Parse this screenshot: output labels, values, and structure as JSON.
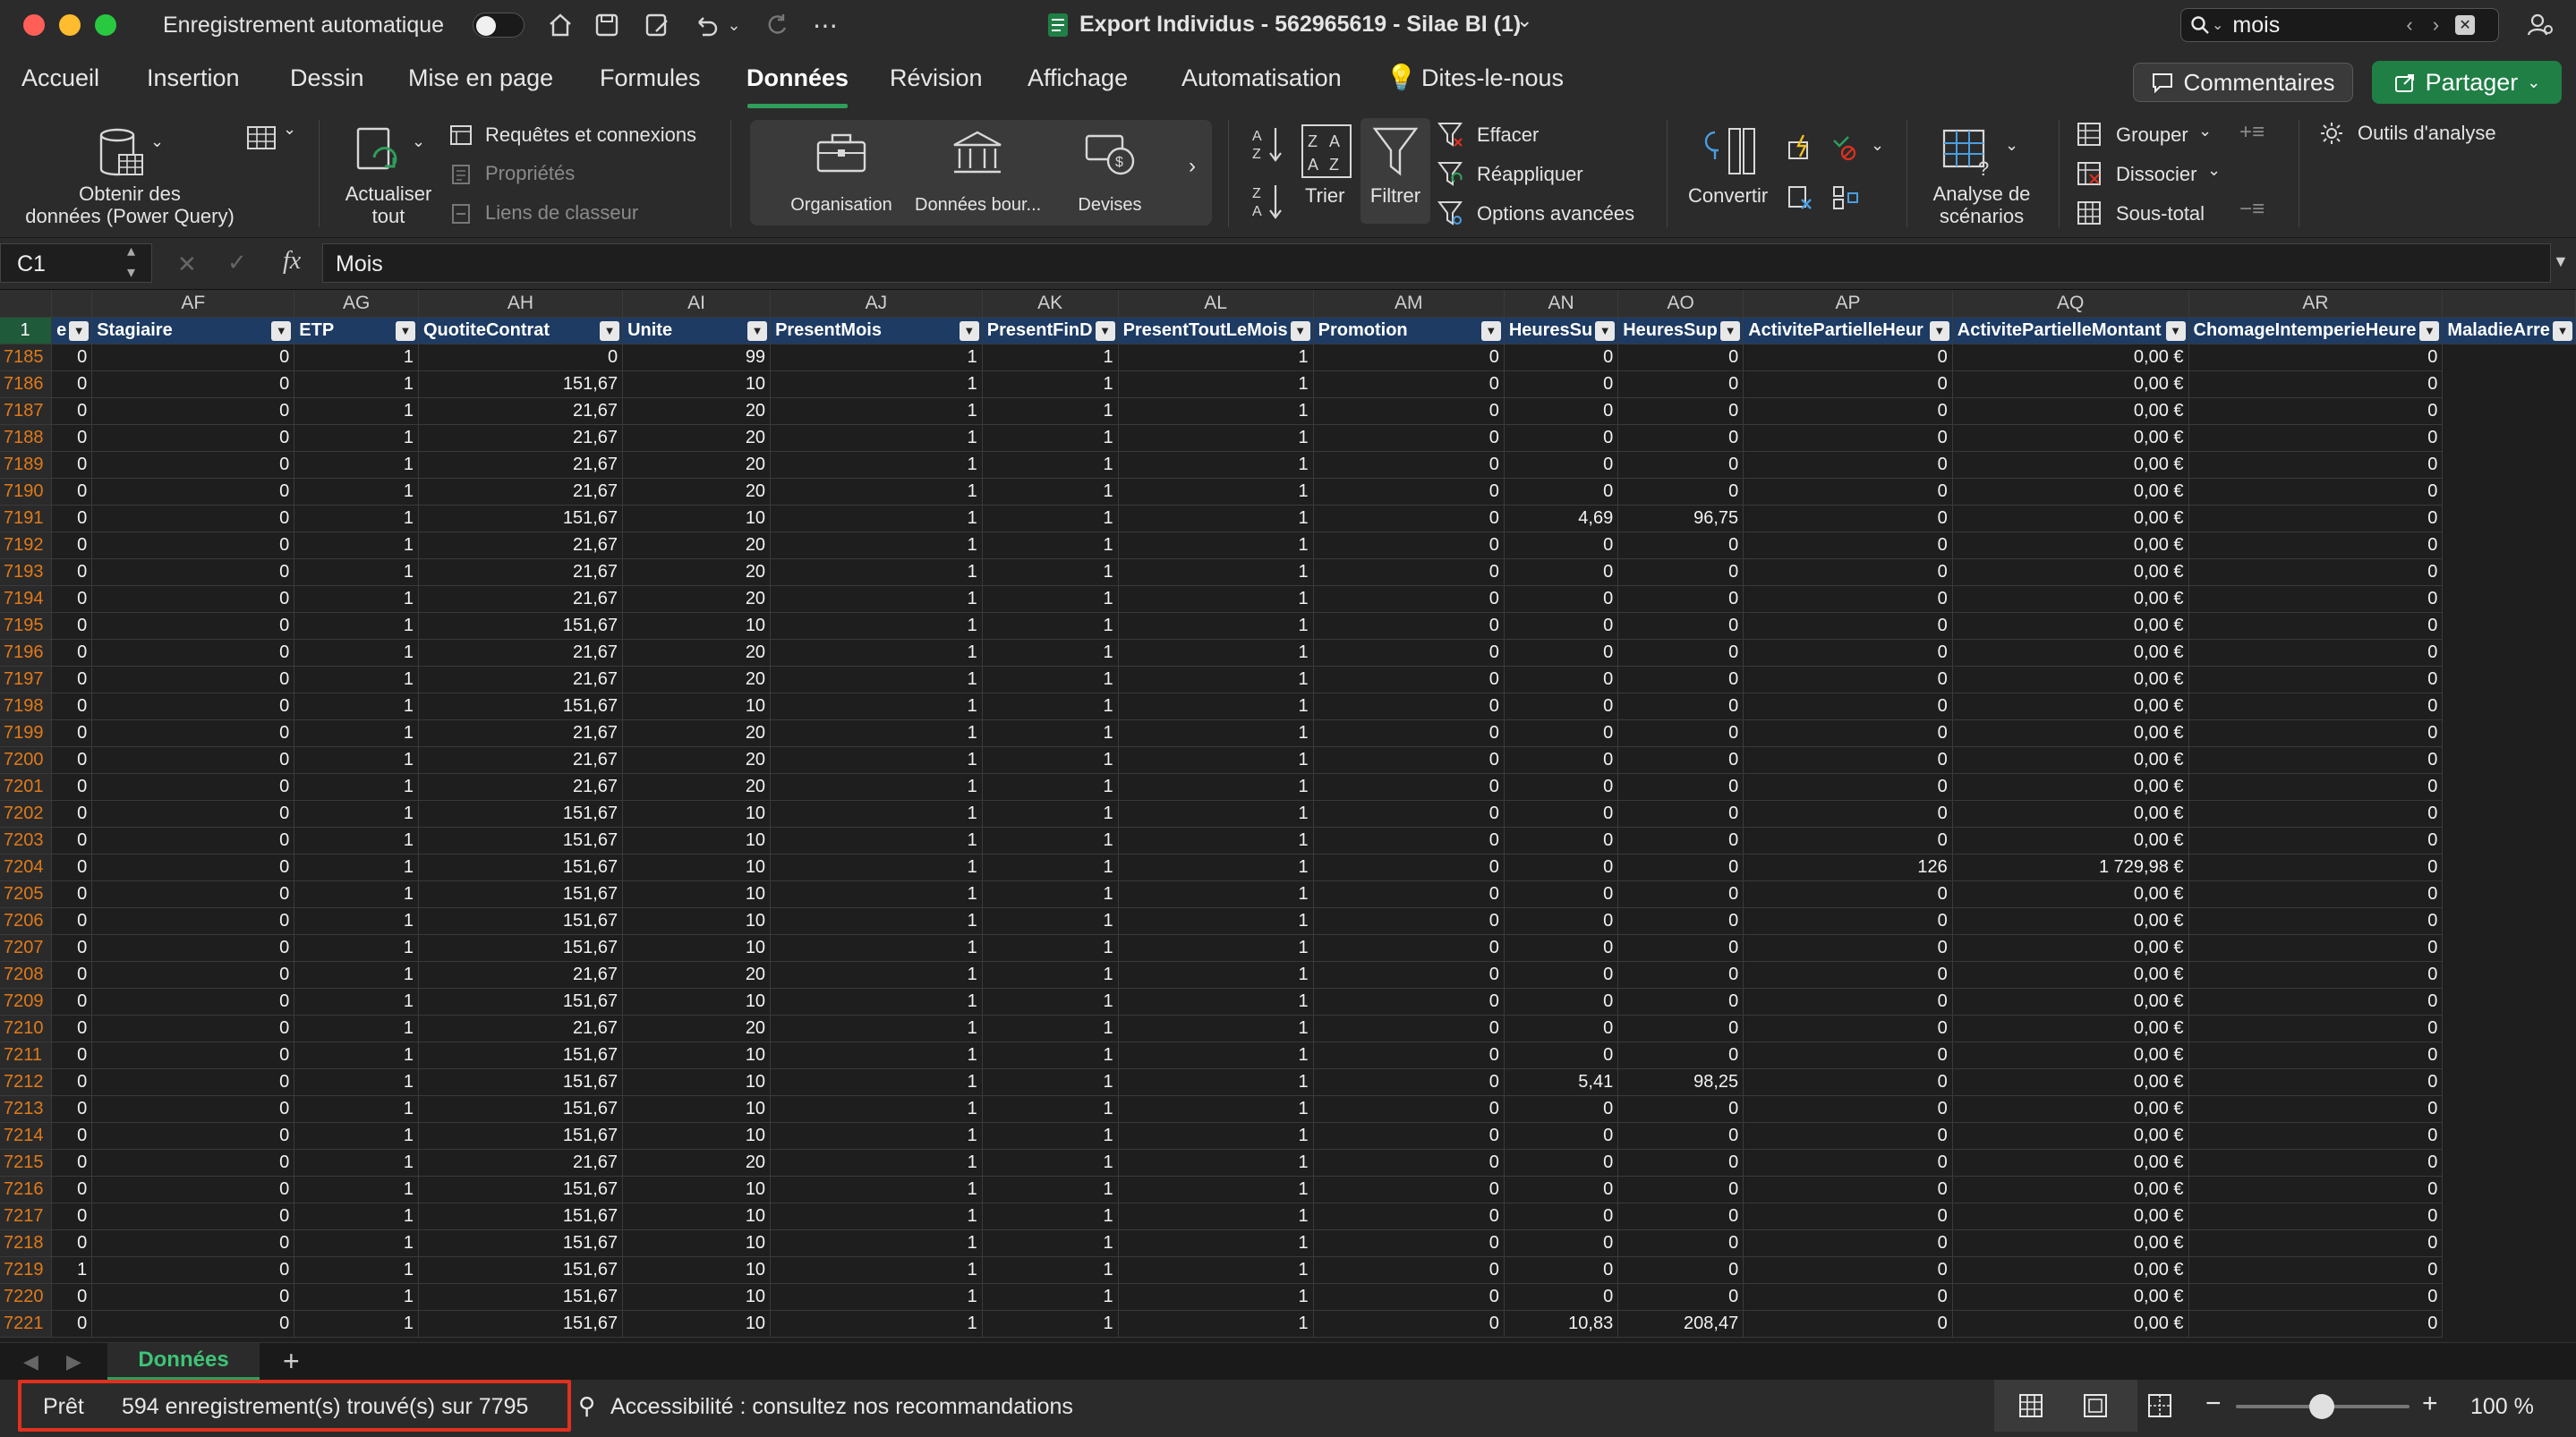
{
  "titlebar": {
    "autosave_label": "Enregistrement automatique",
    "title": "Export Individus - 562965619 - Silae BI (1)",
    "search_value": "mois"
  },
  "menu": {
    "tabs": [
      "Accueil",
      "Insertion",
      "Dessin",
      "Mise en page",
      "Formules",
      "Données",
      "Révision",
      "Affichage",
      "Automatisation",
      "Dites-le-nous"
    ],
    "active": "Données",
    "comments": "Commentaires",
    "share": "Partager"
  },
  "ribbon": {
    "get_data": [
      "Obtenir des",
      "données (Power Query)"
    ],
    "refresh": [
      "Actualiser",
      "tout"
    ],
    "queries": "Requêtes et connexions",
    "properties": "Propriétés",
    "links": "Liens de classeur",
    "dt_org": "Organisation",
    "dt_stock": "Données bour...",
    "dt_currency": "Devises",
    "sort": "Trier",
    "filter": "Filtrer",
    "clear": "Effacer",
    "reapply": "Réappliquer",
    "advanced": "Options avancées",
    "convert": "Convertir",
    "whatif": [
      "Analyse de",
      "scénarios"
    ],
    "group": "Grouper",
    "ungroup": "Dissocier",
    "subtotal": "Sous-total",
    "analysis": "Outils d'analyse"
  },
  "formulabar": {
    "cell": "C1",
    "fx": "fx",
    "value": "Mois"
  },
  "grid": {
    "columns": [
      "AF",
      "AG",
      "AH",
      "AI",
      "AJ",
      "AK",
      "AL",
      "AM",
      "AN",
      "AO",
      "AP",
      "AQ",
      "AR"
    ],
    "headers": [
      "e",
      "Stagiaire",
      "ETP",
      "QuotiteContrat",
      "Unite",
      "PresentMois",
      "PresentFinD",
      "PresentToutLeMois",
      "Promotion",
      "HeuresSu",
      "HeuresSup",
      "ActivitePartielleHeur",
      "ActivitePartielleMontant",
      "ChomageIntemperieHeure",
      "MaladieArre"
    ],
    "rows": [
      [
        "7185",
        "0",
        "0",
        "1",
        "0",
        "99",
        "1",
        "1",
        "1",
        "0",
        "0",
        "0",
        "0",
        "0,00 €",
        "0"
      ],
      [
        "7186",
        "0",
        "0",
        "1",
        "151,67",
        "10",
        "1",
        "1",
        "1",
        "0",
        "0",
        "0",
        "0",
        "0,00 €",
        "0"
      ],
      [
        "7187",
        "0",
        "0",
        "1",
        "21,67",
        "20",
        "1",
        "1",
        "1",
        "0",
        "0",
        "0",
        "0",
        "0,00 €",
        "0"
      ],
      [
        "7188",
        "0",
        "0",
        "1",
        "21,67",
        "20",
        "1",
        "1",
        "1",
        "0",
        "0",
        "0",
        "0",
        "0,00 €",
        "0"
      ],
      [
        "7189",
        "0",
        "0",
        "1",
        "21,67",
        "20",
        "1",
        "1",
        "1",
        "0",
        "0",
        "0",
        "0",
        "0,00 €",
        "0"
      ],
      [
        "7190",
        "0",
        "0",
        "1",
        "21,67",
        "20",
        "1",
        "1",
        "1",
        "0",
        "0",
        "0",
        "0",
        "0,00 €",
        "0"
      ],
      [
        "7191",
        "0",
        "0",
        "1",
        "151,67",
        "10",
        "1",
        "1",
        "1",
        "0",
        "4,69",
        "96,75",
        "0",
        "0,00 €",
        "0"
      ],
      [
        "7192",
        "0",
        "0",
        "1",
        "21,67",
        "20",
        "1",
        "1",
        "1",
        "0",
        "0",
        "0",
        "0",
        "0,00 €",
        "0"
      ],
      [
        "7193",
        "0",
        "0",
        "1",
        "21,67",
        "20",
        "1",
        "1",
        "1",
        "0",
        "0",
        "0",
        "0",
        "0,00 €",
        "0"
      ],
      [
        "7194",
        "0",
        "0",
        "1",
        "21,67",
        "20",
        "1",
        "1",
        "1",
        "0",
        "0",
        "0",
        "0",
        "0,00 €",
        "0"
      ],
      [
        "7195",
        "0",
        "0",
        "1",
        "151,67",
        "10",
        "1",
        "1",
        "1",
        "0",
        "0",
        "0",
        "0",
        "0,00 €",
        "0"
      ],
      [
        "7196",
        "0",
        "0",
        "1",
        "21,67",
        "20",
        "1",
        "1",
        "1",
        "0",
        "0",
        "0",
        "0",
        "0,00 €",
        "0"
      ],
      [
        "7197",
        "0",
        "0",
        "1",
        "21,67",
        "20",
        "1",
        "1",
        "1",
        "0",
        "0",
        "0",
        "0",
        "0,00 €",
        "0"
      ],
      [
        "7198",
        "0",
        "0",
        "1",
        "151,67",
        "10",
        "1",
        "1",
        "1",
        "0",
        "0",
        "0",
        "0",
        "0,00 €",
        "0"
      ],
      [
        "7199",
        "0",
        "0",
        "1",
        "21,67",
        "20",
        "1",
        "1",
        "1",
        "0",
        "0",
        "0",
        "0",
        "0,00 €",
        "0"
      ],
      [
        "7200",
        "0",
        "0",
        "1",
        "21,67",
        "20",
        "1",
        "1",
        "1",
        "0",
        "0",
        "0",
        "0",
        "0,00 €",
        "0"
      ],
      [
        "7201",
        "0",
        "0",
        "1",
        "21,67",
        "20",
        "1",
        "1",
        "1",
        "0",
        "0",
        "0",
        "0",
        "0,00 €",
        "0"
      ],
      [
        "7202",
        "0",
        "0",
        "1",
        "151,67",
        "10",
        "1",
        "1",
        "1",
        "0",
        "0",
        "0",
        "0",
        "0,00 €",
        "0"
      ],
      [
        "7203",
        "0",
        "0",
        "1",
        "151,67",
        "10",
        "1",
        "1",
        "1",
        "0",
        "0",
        "0",
        "0",
        "0,00 €",
        "0"
      ],
      [
        "7204",
        "0",
        "0",
        "1",
        "151,67",
        "10",
        "1",
        "1",
        "1",
        "0",
        "0",
        "0",
        "126",
        "1 729,98 €",
        "0"
      ],
      [
        "7205",
        "0",
        "0",
        "1",
        "151,67",
        "10",
        "1",
        "1",
        "1",
        "0",
        "0",
        "0",
        "0",
        "0,00 €",
        "0"
      ],
      [
        "7206",
        "0",
        "0",
        "1",
        "151,67",
        "10",
        "1",
        "1",
        "1",
        "0",
        "0",
        "0",
        "0",
        "0,00 €",
        "0"
      ],
      [
        "7207",
        "0",
        "0",
        "1",
        "151,67",
        "10",
        "1",
        "1",
        "1",
        "0",
        "0",
        "0",
        "0",
        "0,00 €",
        "0"
      ],
      [
        "7208",
        "0",
        "0",
        "1",
        "21,67",
        "20",
        "1",
        "1",
        "1",
        "0",
        "0",
        "0",
        "0",
        "0,00 €",
        "0"
      ],
      [
        "7209",
        "0",
        "0",
        "1",
        "151,67",
        "10",
        "1",
        "1",
        "1",
        "0",
        "0",
        "0",
        "0",
        "0,00 €",
        "0"
      ],
      [
        "7210",
        "0",
        "0",
        "1",
        "21,67",
        "20",
        "1",
        "1",
        "1",
        "0",
        "0",
        "0",
        "0",
        "0,00 €",
        "0"
      ],
      [
        "7211",
        "0",
        "0",
        "1",
        "151,67",
        "10",
        "1",
        "1",
        "1",
        "0",
        "0",
        "0",
        "0",
        "0,00 €",
        "0"
      ],
      [
        "7212",
        "0",
        "0",
        "1",
        "151,67",
        "10",
        "1",
        "1",
        "1",
        "0",
        "5,41",
        "98,25",
        "0",
        "0,00 €",
        "0"
      ],
      [
        "7213",
        "0",
        "0",
        "1",
        "151,67",
        "10",
        "1",
        "1",
        "1",
        "0",
        "0",
        "0",
        "0",
        "0,00 €",
        "0"
      ],
      [
        "7214",
        "0",
        "0",
        "1",
        "151,67",
        "10",
        "1",
        "1",
        "1",
        "0",
        "0",
        "0",
        "0",
        "0,00 €",
        "0"
      ],
      [
        "7215",
        "0",
        "0",
        "1",
        "21,67",
        "20",
        "1",
        "1",
        "1",
        "0",
        "0",
        "0",
        "0",
        "0,00 €",
        "0"
      ],
      [
        "7216",
        "0",
        "0",
        "1",
        "151,67",
        "10",
        "1",
        "1",
        "1",
        "0",
        "0",
        "0",
        "0",
        "0,00 €",
        "0"
      ],
      [
        "7217",
        "0",
        "0",
        "1",
        "151,67",
        "10",
        "1",
        "1",
        "1",
        "0",
        "0",
        "0",
        "0",
        "0,00 €",
        "0"
      ],
      [
        "7218",
        "0",
        "0",
        "1",
        "151,67",
        "10",
        "1",
        "1",
        "1",
        "0",
        "0",
        "0",
        "0",
        "0,00 €",
        "0"
      ],
      [
        "7219",
        "1",
        "0",
        "1",
        "151,67",
        "10",
        "1",
        "1",
        "1",
        "0",
        "0",
        "0",
        "0",
        "0,00 €",
        "0"
      ],
      [
        "7220",
        "0",
        "0",
        "1",
        "151,67",
        "10",
        "1",
        "1",
        "1",
        "0",
        "0",
        "0",
        "0",
        "0,00 €",
        "0"
      ],
      [
        "7221",
        "0",
        "0",
        "1",
        "151,67",
        "10",
        "1",
        "1",
        "1",
        "0",
        "10,83",
        "208,47",
        "0",
        "0,00 €",
        "0"
      ]
    ]
  },
  "sheets": {
    "active": "Données",
    "add": "+"
  },
  "status": {
    "ready": "Prêt",
    "records": "594 enregistrement(s) trouvé(s) sur 7795",
    "accessibility": "Accessibilité : consultez nos recommandations",
    "zoom": "100 %"
  },
  "colors": {
    "accent": "#2e9e5b",
    "header_blue": "#1d3b63",
    "row_orange": "#e07a1a",
    "highlight_red": "#e0311f"
  }
}
